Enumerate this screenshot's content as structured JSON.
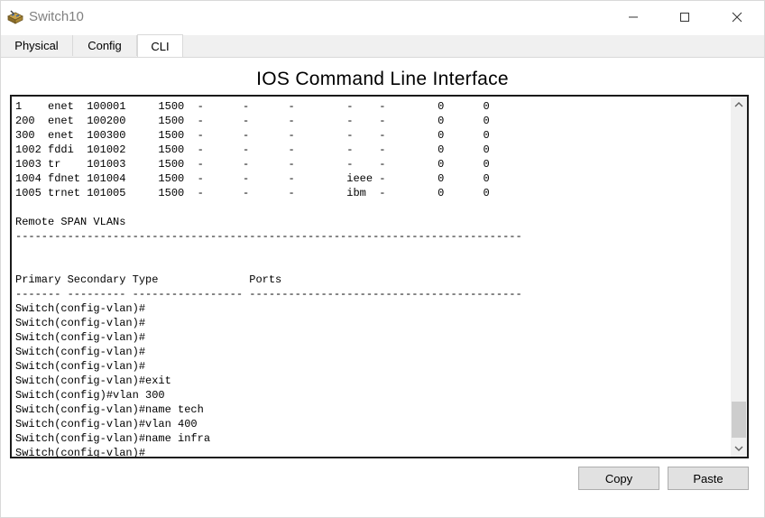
{
  "window": {
    "title": "Switch10",
    "icon": "switch-app-icon"
  },
  "tabs": [
    {
      "label": "Physical",
      "active": false
    },
    {
      "label": "Config",
      "active": false
    },
    {
      "label": "CLI",
      "active": true
    }
  ],
  "cli": {
    "heading": "IOS Command Line Interface",
    "output": "1    enet  100001     1500  -      -      -        -    -        0      0\n200  enet  100200     1500  -      -      -        -    -        0      0\n300  enet  100300     1500  -      -      -        -    -        0      0\n1002 fddi  101002     1500  -      -      -        -    -        0      0\n1003 tr    101003     1500  -      -      -        -    -        0      0\n1004 fdnet 101004     1500  -      -      -        ieee -        0      0\n1005 trnet 101005     1500  -      -      -        ibm  -        0      0\n\nRemote SPAN VLANs\n------------------------------------------------------------------------------\n\n\nPrimary Secondary Type              Ports\n------- --------- ----------------- ------------------------------------------\nSwitch(config-vlan)#\nSwitch(config-vlan)#\nSwitch(config-vlan)#\nSwitch(config-vlan)#\nSwitch(config-vlan)#\nSwitch(config-vlan)#exit\nSwitch(config)#vlan 300\nSwitch(config-vlan)#name tech\nSwitch(config-vlan)#vlan 400\nSwitch(config-vlan)#name infra\nSwitch(config-vlan)#"
  },
  "buttons": {
    "copy": "Copy",
    "paste": "Paste"
  },
  "colors": {
    "title_text": "#808080",
    "tab_strip": "#f0f0f0",
    "terminal_border": "#1a1a1a",
    "button_bg": "#e1e1e1"
  }
}
